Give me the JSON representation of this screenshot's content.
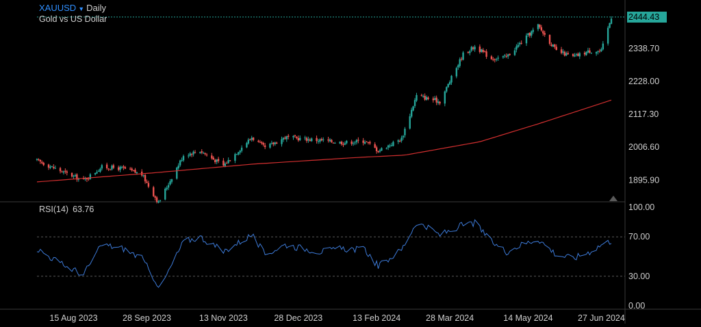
{
  "header": {
    "symbol": "XAUUSD",
    "interval": "Daily",
    "description": "Gold vs US Dollar",
    "dropdown_icon": "triangle-down-icon"
  },
  "price_axis": {
    "ticks": [
      "2338.70",
      "2228.00",
      "2117.30",
      "2006.60",
      "1895.90"
    ],
    "current_price": "2444.43"
  },
  "time_axis": {
    "ticks": [
      "15 Aug 2023",
      "28 Sep 2023",
      "13 Nov 2023",
      "28 Dec 2023",
      "13 Feb 2024",
      "28 Mar 2024",
      "14 May 2024",
      "27 Jun 2024"
    ]
  },
  "rsi": {
    "label": "RSI(14)",
    "value": "63.76",
    "ticks": [
      "100.00",
      "70.00",
      "30.00",
      "0.00"
    ],
    "upper_band": 70,
    "lower_band": 30
  },
  "colors": {
    "up": "#26a69a",
    "down": "#ef5350",
    "ma_line": "#d32f2f",
    "rsi_line": "#3d7bd9",
    "symbol": "#2f8fff",
    "price_tag": "#26a69a"
  },
  "chart_data": [
    {
      "type": "candlestick",
      "title": "Gold vs US Dollar",
      "x_range": [
        "2023-07-24",
        "2024-07-03"
      ],
      "ylim": [
        1830,
        2490
      ],
      "anchors": [
        {
          "date": "2023-07-24",
          "close": 1962
        },
        {
          "date": "2023-08-08",
          "close": 1925
        },
        {
          "date": "2023-08-21",
          "close": 1895
        },
        {
          "date": "2023-09-01",
          "close": 1940
        },
        {
          "date": "2023-09-14",
          "close": 1935
        },
        {
          "date": "2023-09-25",
          "close": 1915
        },
        {
          "date": "2023-10-05",
          "close": 1820
        },
        {
          "date": "2023-10-20",
          "close": 1980
        },
        {
          "date": "2023-10-30",
          "close": 1995
        },
        {
          "date": "2023-11-13",
          "close": 1945
        },
        {
          "date": "2023-11-30",
          "close": 2040
        },
        {
          "date": "2023-12-08",
          "close": 2004
        },
        {
          "date": "2023-12-20",
          "close": 2040
        },
        {
          "date": "2024-01-10",
          "close": 2030
        },
        {
          "date": "2024-01-24",
          "close": 2022
        },
        {
          "date": "2024-02-06",
          "close": 2028
        },
        {
          "date": "2024-02-14",
          "close": 1995
        },
        {
          "date": "2024-02-28",
          "close": 2035
        },
        {
          "date": "2024-03-08",
          "close": 2180
        },
        {
          "date": "2024-03-22",
          "close": 2160
        },
        {
          "date": "2024-04-05",
          "close": 2320
        },
        {
          "date": "2024-04-12",
          "close": 2345
        },
        {
          "date": "2024-04-22",
          "close": 2305
        },
        {
          "date": "2024-05-01",
          "close": 2310
        },
        {
          "date": "2024-05-10",
          "close": 2360
        },
        {
          "date": "2024-05-20",
          "close": 2415
        },
        {
          "date": "2024-05-31",
          "close": 2330
        },
        {
          "date": "2024-06-10",
          "close": 2310
        },
        {
          "date": "2024-06-20",
          "close": 2330
        },
        {
          "date": "2024-06-27",
          "close": 2330
        },
        {
          "date": "2024-07-03",
          "close": 2444
        }
      ],
      "moving_average": [
        {
          "date": "2023-07-24",
          "value": 1890
        },
        {
          "date": "2023-10-01",
          "value": 1920
        },
        {
          "date": "2023-12-01",
          "value": 1950
        },
        {
          "date": "2024-02-01",
          "value": 1972
        },
        {
          "date": "2024-03-01",
          "value": 1980
        },
        {
          "date": "2024-04-15",
          "value": 2025
        },
        {
          "date": "2024-05-20",
          "value": 2085
        },
        {
          "date": "2024-07-03",
          "value": 2165
        }
      ],
      "last_price": 2444.43
    },
    {
      "type": "line",
      "title": "RSI(14)",
      "ylim": [
        0,
        100
      ],
      "points": [
        {
          "date": "2023-07-24",
          "value": 58
        },
        {
          "date": "2023-08-08",
          "value": 42
        },
        {
          "date": "2023-08-21",
          "value": 32
        },
        {
          "date": "2023-09-01",
          "value": 62
        },
        {
          "date": "2023-09-14",
          "value": 58
        },
        {
          "date": "2023-09-25",
          "value": 48
        },
        {
          "date": "2023-10-06",
          "value": 18
        },
        {
          "date": "2023-10-20",
          "value": 65
        },
        {
          "date": "2023-10-30",
          "value": 70
        },
        {
          "date": "2023-11-13",
          "value": 55
        },
        {
          "date": "2023-11-30",
          "value": 72
        },
        {
          "date": "2023-12-08",
          "value": 52
        },
        {
          "date": "2023-12-20",
          "value": 62
        },
        {
          "date": "2024-01-10",
          "value": 55
        },
        {
          "date": "2024-01-24",
          "value": 58
        },
        {
          "date": "2024-02-06",
          "value": 57
        },
        {
          "date": "2024-02-14",
          "value": 40
        },
        {
          "date": "2024-02-28",
          "value": 57
        },
        {
          "date": "2024-03-08",
          "value": 85
        },
        {
          "date": "2024-03-22",
          "value": 72
        },
        {
          "date": "2024-04-05",
          "value": 82
        },
        {
          "date": "2024-04-12",
          "value": 84
        },
        {
          "date": "2024-04-22",
          "value": 65
        },
        {
          "date": "2024-05-01",
          "value": 55
        },
        {
          "date": "2024-05-10",
          "value": 62
        },
        {
          "date": "2024-05-20",
          "value": 68
        },
        {
          "date": "2024-05-31",
          "value": 52
        },
        {
          "date": "2024-06-10",
          "value": 48
        },
        {
          "date": "2024-06-20",
          "value": 55
        },
        {
          "date": "2024-06-27",
          "value": 62
        },
        {
          "date": "2024-07-03",
          "value": 66
        }
      ]
    }
  ]
}
